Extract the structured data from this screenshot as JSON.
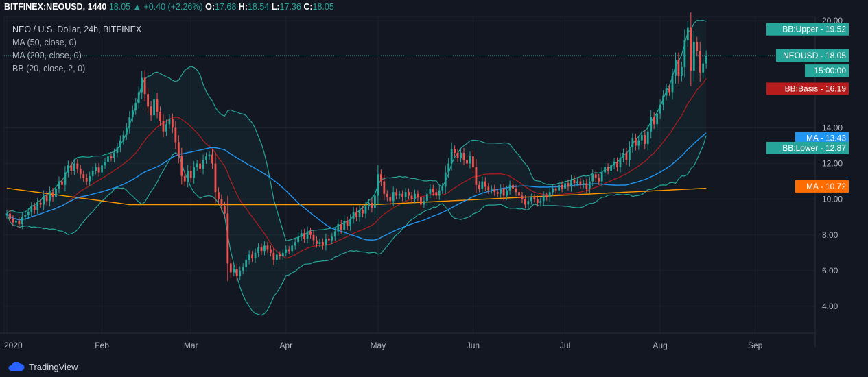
{
  "header": {
    "symbol": "BITFINEX:NEOUSD, 1440",
    "last": "18.05",
    "change": "+0.40 (+2.26%)",
    "o_label": "O:",
    "o_val": "17.68",
    "h_label": "H:",
    "h_val": "18.54",
    "l_label": "L:",
    "l_val": "17.36",
    "c_label": "C:",
    "c_val": "18.05"
  },
  "legend": {
    "title": "NEO / U.S. Dollar, 24h, BITFINEX",
    "ma50": "MA (50, close, 0)",
    "ma200": "MA (200, close, 0)",
    "bb": "BB (20, close, 2, 0)"
  },
  "footer": {
    "brand": "TradingView"
  },
  "colors": {
    "up": "#26a69a",
    "down": "#ef5350",
    "ma50": "#2196f3",
    "ma200": "#ff9800",
    "bb_band": "#26a69a",
    "bb_basis": "#b71c1c",
    "bg": "#131722",
    "grid": "#1e222d"
  },
  "chart_data": {
    "type": "candlestick",
    "y_ticks": [
      "4.00",
      "6.00",
      "8.00",
      "10.00",
      "12.00",
      "14.00",
      "20.00"
    ],
    "ylim": [
      2.5,
      20.2
    ],
    "x_labels": [
      "2020",
      "Feb",
      "Mar",
      "Apr",
      "May",
      "Jun",
      "Jul",
      "Aug",
      "Sep"
    ],
    "x_label_days": [
      0,
      31,
      60,
      91,
      121,
      152,
      182,
      213,
      244
    ],
    "days": 240,
    "price_line": 18.05,
    "axis_labels": [
      {
        "text": "BB:Upper - 19.52",
        "value": 19.52,
        "color": "#26a69a"
      },
      {
        "text": "NEOUSD - 18.05",
        "value": 18.05,
        "color": "#26a69a"
      },
      {
        "text": "15:00:00",
        "value": 17.2,
        "color": "#26a69a"
      },
      {
        "text": "BB:Basis - 16.19",
        "value": 16.19,
        "color": "#b71c1c"
      },
      {
        "text": "MA - 13.43",
        "value": 13.43,
        "color": "#2196f3"
      },
      {
        "text": "BB:Lower - 12.87",
        "value": 12.87,
        "color": "#26a69a"
      },
      {
        "text": "MA - 10.72",
        "value": 10.72,
        "color": "#ff6d00"
      }
    ],
    "closes": [
      9.2,
      8.9,
      8.7,
      8.8,
      8.6,
      9.0,
      9.1,
      9.3,
      9.6,
      9.4,
      9.8,
      9.7,
      10.2,
      9.9,
      10.4,
      10.1,
      10.6,
      11.0,
      10.8,
      11.5,
      11.9,
      11.6,
      12.0,
      11.7,
      11.4,
      11.2,
      11.0,
      11.3,
      11.6,
      11.8,
      11.5,
      11.9,
      12.1,
      12.4,
      12.3,
      12.6,
      12.9,
      13.3,
      13.6,
      14.0,
      14.6,
      15.0,
      15.4,
      16.0,
      16.8,
      15.9,
      15.2,
      14.7,
      15.6,
      14.9,
      14.4,
      13.8,
      14.2,
      14.5,
      14.0,
      13.2,
      12.4,
      11.3,
      11.0,
      11.6,
      11.2,
      11.8,
      12.0,
      11.7,
      12.2,
      12.4,
      12.5,
      12.0,
      10.4,
      10.0,
      9.6,
      9.2,
      6.4,
      5.9,
      6.1,
      5.7,
      6.0,
      6.2,
      6.6,
      6.9,
      6.7,
      7.0,
      7.3,
      7.1,
      7.4,
      7.2,
      7.0,
      6.6,
      6.9,
      6.8,
      7.0,
      7.2,
      7.1,
      7.4,
      7.6,
      7.9,
      8.1,
      7.8,
      8.2,
      8.0,
      7.7,
      7.5,
      7.6,
      7.4,
      7.8,
      7.7,
      7.9,
      8.2,
      8.6,
      8.3,
      8.8,
      8.5,
      8.9,
      9.3,
      9.0,
      9.4,
      9.2,
      9.6,
      9.8,
      9.5,
      10.2,
      11.4,
      11.0,
      10.3,
      10.1,
      9.9,
      10.4,
      10.2,
      10.3,
      10.1,
      10.4,
      10.2,
      10.0,
      10.3,
      10.1,
      9.7,
      9.9,
      10.3,
      10.6,
      10.4,
      10.2,
      10.5,
      10.7,
      11.5,
      12.0,
      12.8,
      12.6,
      12.3,
      12.6,
      12.2,
      12.0,
      12.4,
      11.8,
      10.8,
      10.6,
      11.0,
      10.7,
      10.5,
      10.6,
      10.4,
      10.3,
      10.6,
      10.2,
      10.5,
      10.8,
      10.6,
      10.4,
      10.2,
      10.0,
      9.7,
      9.9,
      10.1,
      10.0,
      9.8,
      9.9,
      10.2,
      10.1,
      10.4,
      10.6,
      10.5,
      10.8,
      10.6,
      10.9,
      10.7,
      11.1,
      10.9,
      11.0,
      10.8,
      10.9,
      10.6,
      11.0,
      11.4,
      11.2,
      11.0,
      11.5,
      11.8,
      11.6,
      11.9,
      12.1,
      11.8,
      12.3,
      12.6,
      12.2,
      12.9,
      13.4,
      13.0,
      13.3,
      13.6,
      13.1,
      13.8,
      14.6,
      14.2,
      14.8,
      15.3,
      15.8,
      16.2,
      16.0,
      16.9,
      17.8,
      16.9,
      17.4,
      18.9,
      19.6,
      17.2,
      18.8,
      18.3,
      17.1,
      17.6,
      18.05
    ]
  }
}
